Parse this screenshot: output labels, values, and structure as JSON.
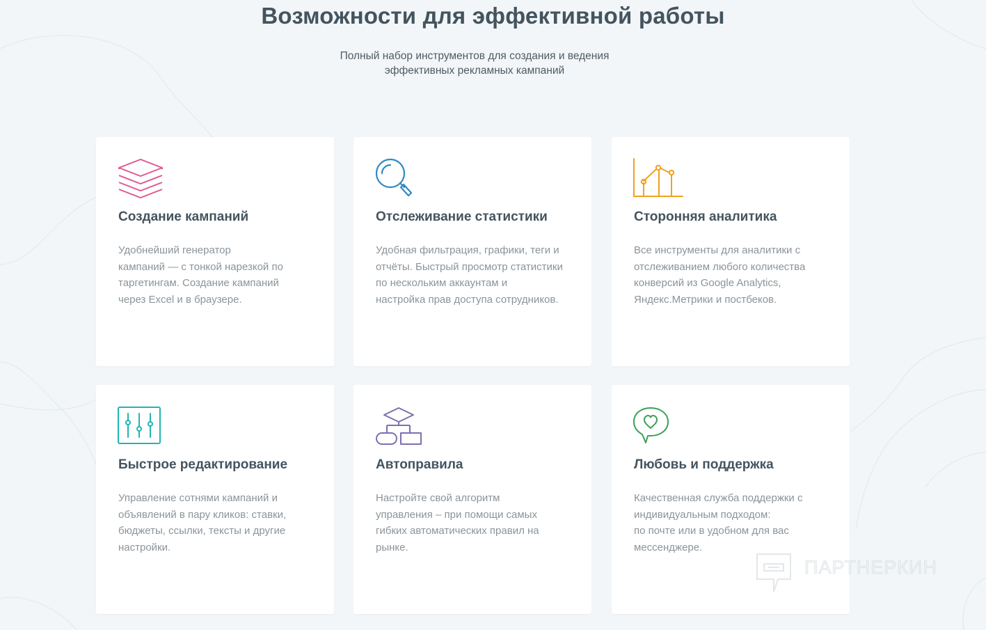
{
  "header": {
    "title": "Возможности для эффективной работы",
    "subtitle_line1": "Полный набор инструментов для создания и ведения",
    "subtitle_line2": "эффективных рекламных кампаний"
  },
  "features": [
    {
      "icon": "layers-icon",
      "icon_color": "#e0578f",
      "title": "Создание кампаний",
      "lines": [
        "Удобнейший генератор",
        "кампаний — с тонкой нарезкой по",
        "таргетингам. Создание кампаний",
        "через Excel и в браузере."
      ]
    },
    {
      "icon": "magnifier-icon",
      "icon_color": "#2f8ac4",
      "title": "Отслеживание статистики",
      "lines": [
        "Удобная фильтрация, графики, теги и",
        "отчёты. Быстрый просмотр статистики",
        "по нескольким аккаунтам и",
        "настройка прав доступа сотрудников."
      ]
    },
    {
      "icon": "analytics-chart-icon",
      "icon_color": "#f0a21d",
      "title": "Сторонняя аналитика",
      "lines": [
        "Все инструменты для аналитики с",
        "отслеживанием любого количества",
        "конверсий из Google Analytics,",
        "Яндекс.Метрики и постбеков."
      ]
    },
    {
      "icon": "sliders-icon",
      "icon_color": "#1fb5b5",
      "title": "Быстрое редактирование",
      "lines": [
        "Управление сотнями кампаний и",
        "объявлений в пару кликов: ставки,",
        "бюджеты, ссылки, тексты и другие",
        "настройки."
      ]
    },
    {
      "icon": "flowchart-icon",
      "icon_color": "#7d6fb0",
      "title": "Автоправила",
      "lines": [
        "Настройте свой алгоритм",
        "управления – при помощи самых",
        "гибких автоматических правил на",
        "рынке."
      ]
    },
    {
      "icon": "heart-chat-icon",
      "icon_color": "#3aa05a",
      "title": "Любовь и поддержка",
      "lines": [
        "Качественная служба поддержки с",
        "индивидуальным подходом:",
        "по почте или в удобном для вас",
        "мессенджере."
      ]
    }
  ],
  "watermark": {
    "text": "ПАРТНЕРКИН"
  }
}
